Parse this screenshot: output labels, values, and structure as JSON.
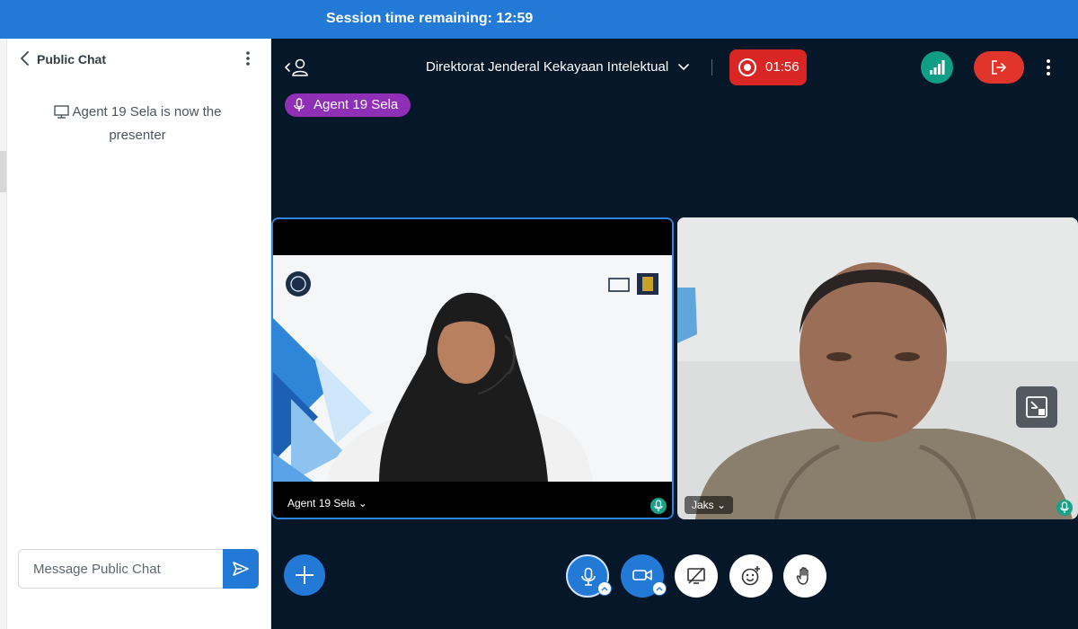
{
  "session": {
    "text": "Session time remaining: 12:59"
  },
  "chat": {
    "title": "Public Chat",
    "system_message": "Agent 19 Sela is now the presenter",
    "input_placeholder": "Message Public Chat",
    "back_icon": "chevron-left-icon",
    "more_icon": "kebab-menu-icon",
    "send_icon": "send-icon"
  },
  "header": {
    "meeting_title": "Direktorat Jenderal Kekayaan Intelektual",
    "recording_time": "01:56"
  },
  "talking_indicator": {
    "name": "Agent 19 Sela"
  },
  "videos": [
    {
      "name": "Agent 19 Sela",
      "caret": "⌄"
    },
    {
      "name": "Jaks",
      "caret": "⌄"
    }
  ],
  "colors": {
    "accent": "#2279d6",
    "stage_bg": "#06172a",
    "recording": "#d92524",
    "leave": "#e1342b",
    "connection": "#109e87",
    "talker": "#8e2fb6"
  }
}
